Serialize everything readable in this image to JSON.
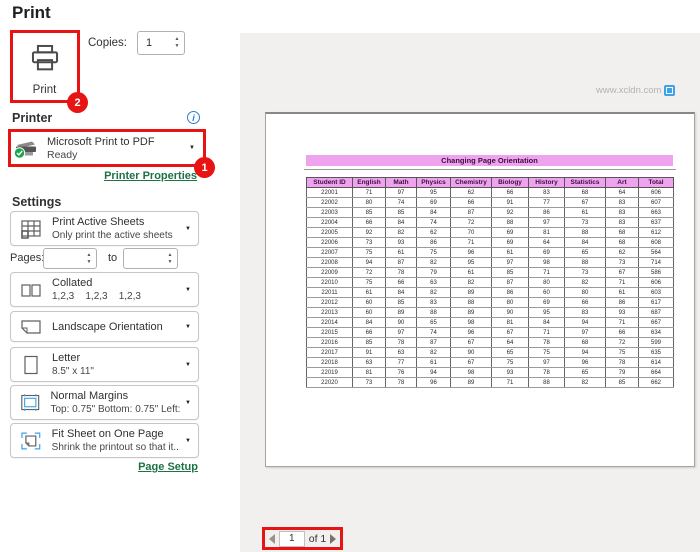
{
  "page": {
    "title": "Print"
  },
  "icons": {
    "caret_down": "▼",
    "spinner_up": "▲",
    "spinner_down": "▼",
    "info": "i"
  },
  "annotations": {
    "badge_printer": "1",
    "badge_print": "2"
  },
  "print_button": {
    "label": "Print"
  },
  "copies": {
    "label": "Copies:",
    "value": "1"
  },
  "printer": {
    "section_label": "Printer",
    "name": "Microsoft Print to PDF",
    "status": "Ready",
    "properties_link": "Printer Properties"
  },
  "settings": {
    "section_label": "Settings",
    "pages": {
      "label": "Pages:",
      "to_label": "to",
      "from_value": "",
      "to_value": ""
    },
    "items": [
      {
        "icon": "sheet-grid-icon",
        "title": "Print Active Sheets",
        "subtitle": "Only print the active sheets"
      },
      {
        "icon": "collated-icon",
        "title": "Collated",
        "subtitle": "1,2,3    1,2,3    1,2,3"
      },
      {
        "icon": "landscape-icon",
        "title": "Landscape Orientation",
        "subtitle": ""
      },
      {
        "icon": "letter-icon",
        "title": "Letter",
        "subtitle": "8.5\" x 11\""
      },
      {
        "icon": "margins-icon",
        "title": "Normal Margins",
        "subtitle": "Top: 0.75\" Bottom: 0.75\" Left:..."
      },
      {
        "icon": "fit-sheet-icon",
        "title": "Fit Sheet on One Page",
        "subtitle": "Shrink the printout so that it..."
      }
    ],
    "page_setup_link": "Page Setup"
  },
  "sheet": {
    "title": "Changing Page Orientation",
    "columns": [
      "Student ID",
      "English",
      "Math",
      "Physics",
      "Chemistry",
      "Biology",
      "History",
      "Statistics",
      "Art",
      "Total"
    ],
    "rows": [
      [
        22001,
        71,
        97,
        95,
        62,
        66,
        83,
        68,
        64,
        606
      ],
      [
        22002,
        80,
        74,
        69,
        66,
        91,
        77,
        67,
        83,
        607
      ],
      [
        22003,
        85,
        85,
        84,
        87,
        92,
        86,
        61,
        83,
        663
      ],
      [
        22004,
        66,
        84,
        74,
        72,
        88,
        97,
        73,
        83,
        637
      ],
      [
        22005,
        92,
        82,
        62,
        70,
        69,
        81,
        88,
        68,
        612
      ],
      [
        22006,
        73,
        93,
        86,
        71,
        69,
        64,
        84,
        68,
        608
      ],
      [
        22007,
        75,
        61,
        75,
        96,
        61,
        69,
        65,
        62,
        564
      ],
      [
        22008,
        94,
        87,
        82,
        95,
        97,
        98,
        88,
        73,
        714
      ],
      [
        22009,
        72,
        78,
        79,
        61,
        85,
        71,
        73,
        67,
        586
      ],
      [
        22010,
        75,
        66,
        63,
        82,
        87,
        80,
        82,
        71,
        606
      ],
      [
        22011,
        61,
        84,
        82,
        89,
        86,
        60,
        80,
        61,
        603
      ],
      [
        22012,
        60,
        85,
        83,
        88,
        80,
        69,
        66,
        86,
        617
      ],
      [
        22013,
        60,
        89,
        88,
        89,
        90,
        95,
        83,
        93,
        687
      ],
      [
        22014,
        84,
        90,
        65,
        98,
        81,
        84,
        94,
        71,
        667
      ],
      [
        22015,
        66,
        97,
        74,
        96,
        67,
        71,
        97,
        66,
        634
      ],
      [
        22016,
        85,
        78,
        87,
        67,
        64,
        78,
        68,
        72,
        599
      ],
      [
        22017,
        91,
        63,
        82,
        90,
        65,
        75,
        94,
        75,
        635
      ],
      [
        22018,
        63,
        77,
        61,
        67,
        75,
        97,
        96,
        78,
        614
      ],
      [
        22019,
        81,
        76,
        94,
        98,
        93,
        78,
        65,
        79,
        664
      ],
      [
        22020,
        73,
        78,
        96,
        89,
        71,
        88,
        82,
        85,
        662
      ]
    ]
  },
  "preview_nav": {
    "current_page": "1",
    "of_label": "of 1"
  },
  "watermark": {
    "text": "www.xcldn.com"
  },
  "colors": {
    "annotation_red": "#e81414",
    "link_green": "#1e7145",
    "pink_header": "#efa3ef",
    "pink_text": "#3c0f3c",
    "preview_gray": "#f1f0ee",
    "check_green": "#1aa74a"
  }
}
